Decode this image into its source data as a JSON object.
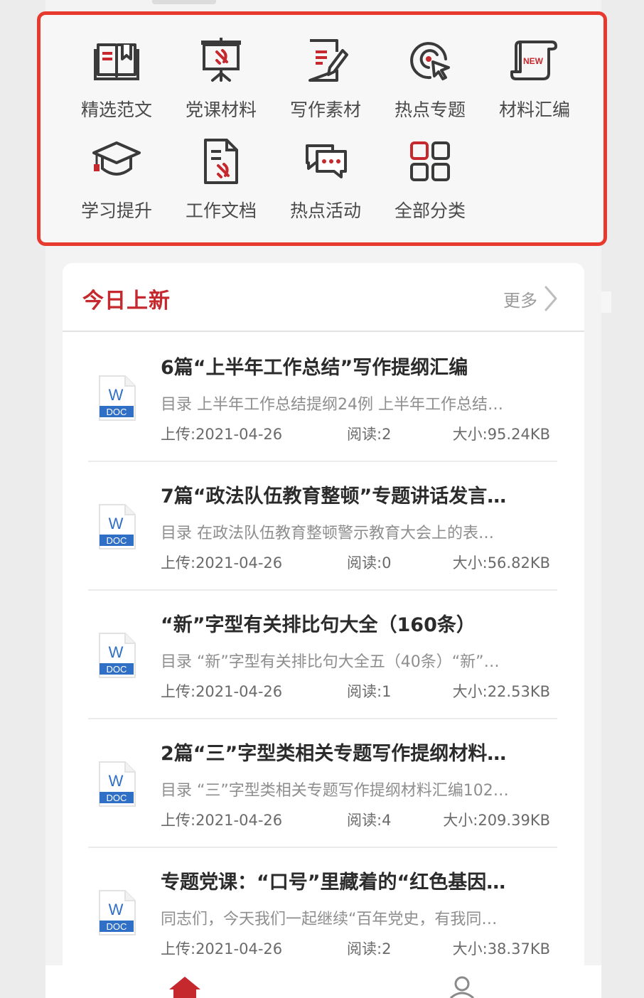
{
  "categories": [
    {
      "label": "精选范文",
      "icon": "book-icon"
    },
    {
      "label": "党课材料",
      "icon": "party-lectern-icon"
    },
    {
      "label": "写作素材",
      "icon": "write-document-icon"
    },
    {
      "label": "热点专题",
      "icon": "target-click-icon"
    },
    {
      "label": "材料汇编",
      "icon": "new-scroll-icon"
    },
    {
      "label": "学习提升",
      "icon": "graduation-cap-icon"
    },
    {
      "label": "工作文档",
      "icon": "party-document-icon"
    },
    {
      "label": "热点活动",
      "icon": "chat-bubbles-icon"
    },
    {
      "label": "全部分类",
      "icon": "grid-icon"
    }
  ],
  "news_section": {
    "title": "今日上新",
    "more_label": "更多"
  },
  "doc_icon": {
    "letter": "W",
    "tag": "DOC"
  },
  "news_items": [
    {
      "title": "6篇“上半年工作总结”写作提纲汇编",
      "desc": "目录 上半年工作总结提纲24例 上半年工作总结…",
      "upload": "上传:2021-04-26",
      "read": "阅读:2",
      "size": "大小:95.24KB"
    },
    {
      "title": "7篇“政法队伍教育整顿”专题讲话发言…",
      "desc": "目录 在政法队伍教育整顿警示教育大会上的表…",
      "upload": "上传:2021-04-26",
      "read": "阅读:0",
      "size": "大小:56.82KB"
    },
    {
      "title": "“新”字型有关排比句大全（160条）",
      "desc": "目录 “新”字型有关排比句大全五（40条）“新”…",
      "upload": "上传:2021-04-26",
      "read": "阅读:1",
      "size": "大小:22.53KB"
    },
    {
      "title": "2篇“三”字型类相关专题写作提纲材料…",
      "desc": "目录 “三”字型类相关专题写作提纲材料汇编102…",
      "upload": "上传:2021-04-26",
      "read": "阅读:4",
      "size": "大小:209.39KB"
    },
    {
      "title": "专题党课：“口号”里藏着的“红色基因…",
      "desc": "同志们，今天我们一起继续“百年党史，有我同…",
      "upload": "上传:2021-04-26",
      "read": "阅读:2",
      "size": "大小:38.37KB"
    }
  ],
  "bottom_nav": [
    {
      "icon": "home-icon"
    },
    {
      "icon": "user-icon"
    }
  ],
  "colors": {
    "accent": "#c5282d",
    "highlight_border": "#e8392f",
    "doc_blue": "#2f6fc6",
    "icon_dark": "#3a3a3a"
  }
}
